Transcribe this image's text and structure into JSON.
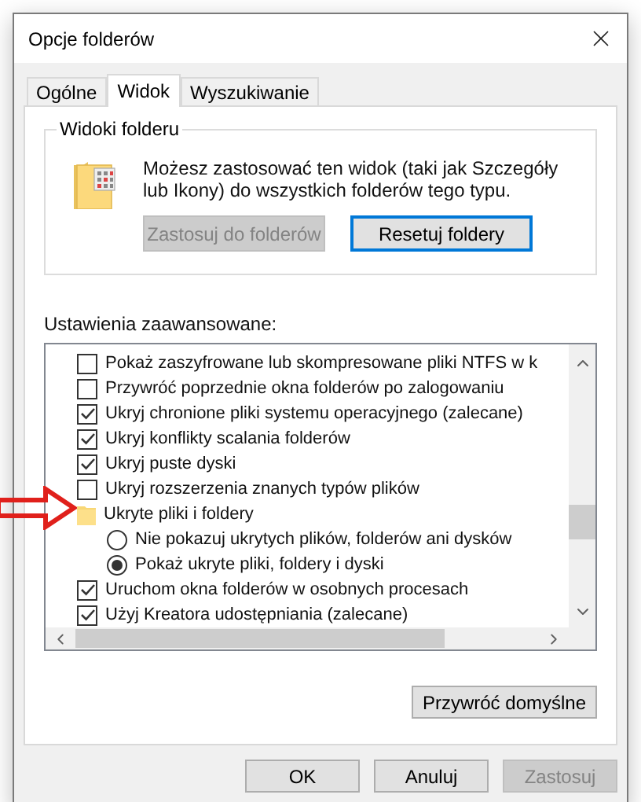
{
  "window": {
    "title": "Opcje folderów"
  },
  "tabs": [
    {
      "label": "Ogólne",
      "selected": false
    },
    {
      "label": "Widok",
      "selected": true
    },
    {
      "label": "Wyszukiwanie",
      "selected": false
    }
  ],
  "folder_views": {
    "title": "Widoki folderu",
    "description": "Możesz zastosować ten widok (taki jak Szczegóły lub Ikony) do wszystkich folderów tego typu.",
    "buttons": [
      {
        "label": "Zastosuj do folderów",
        "disabled": true,
        "focused": false
      },
      {
        "label": "Resetuj foldery",
        "disabled": false,
        "focused": true
      }
    ]
  },
  "advanced": {
    "label": "Ustawienia zaawansowane:",
    "items": [
      {
        "kind": "checkbox",
        "label": "Pokaż zaszyfrowane lub skompresowane pliki NTFS w k",
        "checked": false
      },
      {
        "kind": "checkbox",
        "label": "Przywróć poprzednie okna folderów po zalogowaniu",
        "checked": false
      },
      {
        "kind": "checkbox",
        "label": "Ukryj chronione pliki systemu operacyjnego (zalecane)",
        "checked": true
      },
      {
        "kind": "checkbox",
        "label": "Ukryj konflikty scalania folderów",
        "checked": true
      },
      {
        "kind": "checkbox",
        "label": "Ukryj puste dyski",
        "checked": true
      },
      {
        "kind": "checkbox",
        "label": "Ukryj rozszerzenia znanych typów plików",
        "checked": false
      },
      {
        "kind": "folder",
        "label": "Ukryte pliki i foldery",
        "children": [
          {
            "kind": "radio",
            "label": "Nie pokazuj ukrytych plików, folderów ani dysków",
            "selected": false
          },
          {
            "kind": "radio",
            "label": "Pokaż ukryte pliki, foldery i dyski",
            "selected": true
          }
        ]
      },
      {
        "kind": "checkbox",
        "label": "Uruchom okna folderów w osobnych procesach",
        "checked": true
      },
      {
        "kind": "checkbox",
        "label": "Użyj Kreatora udostępniania (zalecane)",
        "checked": true
      }
    ],
    "restore_button": "Przywróć domyślne"
  },
  "buttons": [
    {
      "label": "OK",
      "disabled": false
    },
    {
      "label": "Anuluj",
      "disabled": false
    },
    {
      "label": "Zastosuj",
      "disabled": true
    }
  ]
}
